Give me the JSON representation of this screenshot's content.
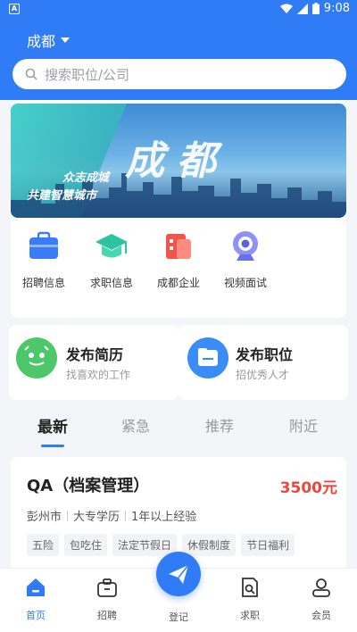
{
  "status_bar": {
    "time": "9:08"
  },
  "header": {
    "city": "成都"
  },
  "search": {
    "placeholder": "搜索职位/公司"
  },
  "banner": {
    "big_text": "成都",
    "slogan_1": "众志成城",
    "slogan_2": "共建智慧城市"
  },
  "quick_menu": [
    {
      "label": "招聘信息",
      "icon": "briefcase-icon",
      "color": "#3a7bf6"
    },
    {
      "label": "求职信息",
      "icon": "graduation-cap-icon",
      "color": "#2fc2a0"
    },
    {
      "label": "成都企业",
      "icon": "enterprise-icon",
      "color": "#f0554a"
    },
    {
      "label": "视频面试",
      "icon": "webcam-icon",
      "color": "#6a6ff0"
    }
  ],
  "actions": [
    {
      "title": "发布简历",
      "subtitle": "找喜欢的工作",
      "icon": "smile-face-icon",
      "color": "#4cc76a"
    },
    {
      "title": "发布职位",
      "subtitle": "招优秀人才",
      "icon": "folder-icon",
      "color": "#3a8df6"
    }
  ],
  "tabs": [
    {
      "label": "最新",
      "active": true
    },
    {
      "label": "紧急",
      "active": false
    },
    {
      "label": "推荐",
      "active": false
    },
    {
      "label": "附近",
      "active": false
    }
  ],
  "job": {
    "title": "QA（档案管理）",
    "salary": "3500元",
    "location": "彭州市",
    "education": "大专学历",
    "experience": "1年以上经验",
    "tags": [
      "五险",
      "包吃住",
      "法定节假日",
      "休假制度",
      "节日福利"
    ]
  },
  "tabbar": [
    {
      "label": "首页",
      "icon": "home-icon",
      "active": true
    },
    {
      "label": "招聘",
      "icon": "briefcase-icon",
      "active": false
    },
    {
      "label": "登记",
      "icon": "paper-plane-icon",
      "active": false
    },
    {
      "label": "求职",
      "icon": "document-search-icon",
      "active": false
    },
    {
      "label": "会员",
      "icon": "user-icon",
      "active": false
    }
  ],
  "colors": {
    "primary": "#2f7cf6",
    "salary": "#f0443a"
  }
}
